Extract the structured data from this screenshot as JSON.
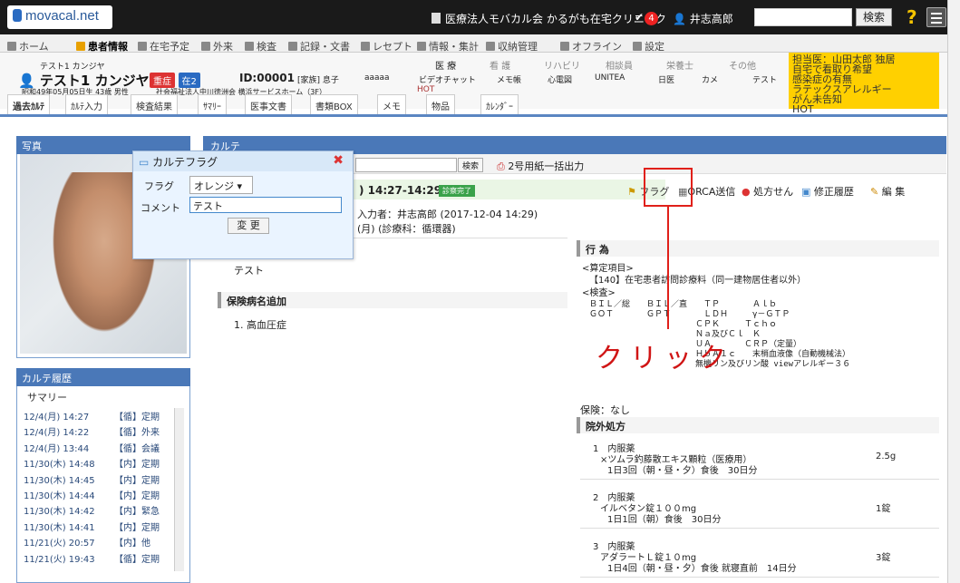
{
  "top": {
    "logo": "movacal.net",
    "clinic": "医療法人モバカル会 かるがも在宅クリニック",
    "badge": "4",
    "user": "井志高郎",
    "search_btn": "検索",
    "help": "?"
  },
  "nav": [
    "ホーム",
    "患者情報",
    "在宅予定",
    "外来",
    "検査",
    "記録・文書",
    "レセプト",
    "情報・集計",
    "収納管理",
    "オフライン",
    "設定"
  ],
  "patient": {
    "kana": "テスト1 カンジヤ",
    "name": "テスト1 カンジヤ",
    "tag1": "重症",
    "tag2": "在2",
    "id": "ID:00001",
    "family": "[家族] 息子",
    "aaaaa": "aaaaa",
    "video": "ビデオチャット",
    "memo": "メモ帳",
    "ecg": "心電図",
    "unitea": "UNITEA",
    "nikki": "日医",
    "camera": "カメ",
    "test": "テスト",
    "dob": "昭和49年05月05日生 43歳 男性",
    "facility": "社会福祉法人中川徳洲会 横浜サービスホーム（3F）",
    "hot": "HOT"
  },
  "staff": [
    "医 療",
    "看 護",
    "リハビリ",
    "相談員",
    "栄養士",
    "その他"
  ],
  "alert": [
    "担当医：山田太郎 独居",
    "自宅で看取り希望",
    "感染症の有無",
    "ラテックスアレルギー",
    "がん未告知",
    "HOT"
  ],
  "subtabs": [
    "過去ｶﾙﾃ",
    "ｶﾙﾃ入力",
    "検査結果",
    "ｻﾏﾘｰ",
    "医事文書",
    "書類BOX",
    "メモ",
    "物品",
    "ｶﾚﾝﾀﾞｰ"
  ],
  "photo_hdr": "写真",
  "hist": {
    "hdr": "カルテ履歴",
    "summary": "サマリー",
    "rows": [
      [
        "12/4(月) 14:27",
        "【循】",
        "定期"
      ],
      [
        "12/4(月) 14:22",
        "【循】",
        "外来"
      ],
      [
        "12/4(月) 13:44",
        "【循】",
        "会議"
      ],
      [
        "11/30(木) 14:48",
        "【内】",
        "定期"
      ],
      [
        "11/30(木) 14:45",
        "【内】",
        "定期"
      ],
      [
        "11/30(木) 14:44",
        "【内】",
        "定期"
      ],
      [
        "11/30(木) 14:42",
        "【内】",
        "緊急"
      ],
      [
        "11/30(木) 14:41",
        "【内】",
        "定期"
      ],
      [
        "11/21(火) 20:57",
        "【内】",
        "他"
      ],
      [
        "11/21(火) 19:43",
        "【循】",
        "定期"
      ]
    ]
  },
  "karte": {
    "hdr": "カルテ",
    "search_btn": "検索",
    "print": "2号用紙一括出力",
    "visit_time": ") 14:27-14:29",
    "status": "診察完了",
    "flag": "フラグ",
    "orca": "ORCA送信",
    "rx": "処方せん",
    "history": "修正履歴",
    "edit": "編 集",
    "inputter": "入力者：井志高郎 (2017-12-04 14:29)",
    "day": "(月) (診療科：循環器)",
    "note": "テスト",
    "dx_hdr": "保険病名追加",
    "dx": "1. 高血圧症"
  },
  "dialog": {
    "title": "カルテフラグ",
    "flag_lbl": "フラグ",
    "flag_val": "オレンジ ▾",
    "comment_lbl": "コメント",
    "comment_val": "テスト",
    "btn": "変 更"
  },
  "acts": {
    "hdr": "行 為",
    "calc": "<算定項目>",
    "calc1": "【140】在宅患者訪問診療料（同一建物居住者以外）",
    "exam": "<検査>",
    "tests": [
      "ＢＩＬ／総　　ＢＩＬ／直　　ＴＰ　　　　Ａｌｂ",
      "ＧＯＴ　　　　ＧＰＴ　　　　ＬＤＨ　　　γ－ＧＴＰ",
      "　　　　　　　　　　　　　ＣＰＫ　　　Ｔｃｈｏ",
      "　　　　　　　　　　　　　Ｎａ及びＣｌ　Ｋ",
      "　　　　　　　　　　　　　ＵＡ　　　　ＣＲＰ（定量）",
      "　　　　　　　　　　　　　ＨｂＡ１ｃ　　末梢血液像（自動機械法）",
      "　　　　　　　　　　　　　無機リン及びリン酸 viewアレルギー３６"
    ],
    "ins": "保険：なし",
    "rx_hdr": "院外処方",
    "rx": [
      {
        "n": "1　内服薬",
        "d": "×ツムラ釣藤散エキス顆粒（医療用）",
        "q": "2.5g",
        "u": "1日3回（朝・昼・夕）食後　30日分"
      },
      {
        "n": "2　内服薬",
        "d": "イルベタン錠１００mg",
        "q": "1錠",
        "u": "1日1回（朝）食後　30日分"
      },
      {
        "n": "3　内服薬",
        "d": "アダラートＬ錠１０mg",
        "q": "3錠",
        "u": "1日4回（朝・昼・夕）食後 就寝直前　14日分"
      }
    ]
  },
  "annotation": "クリック"
}
